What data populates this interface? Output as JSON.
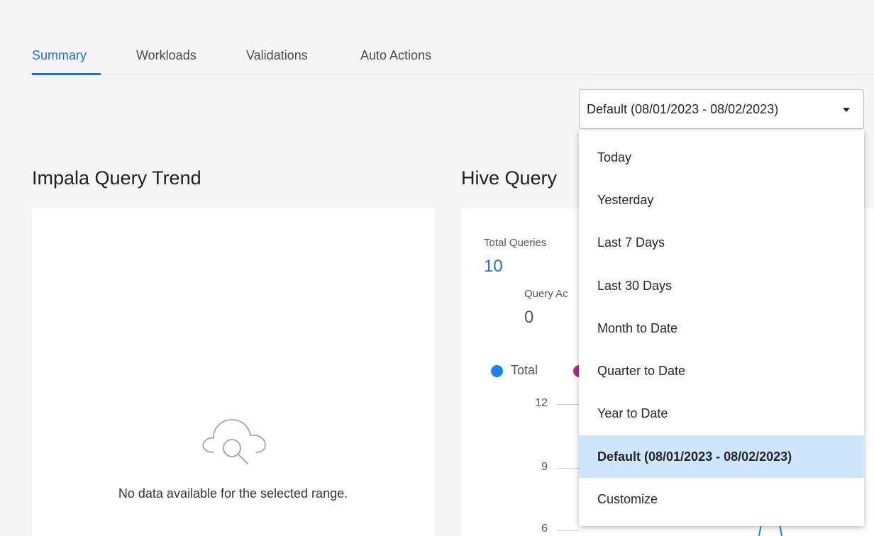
{
  "tabs": [
    {
      "label": "Summary",
      "active": true
    },
    {
      "label": "Workloads",
      "active": false
    },
    {
      "label": "Validations",
      "active": false
    },
    {
      "label": "Auto Actions",
      "active": false
    }
  ],
  "date_range": {
    "selected": "Default (08/01/2023 - 08/02/2023)",
    "options": [
      "Today",
      "Yesterday",
      "Last 7 Days",
      "Last 30 Days",
      "Month to Date",
      "Quarter to Date",
      "Year to Date",
      "Default (08/01/2023 - 08/02/2023)",
      "Customize"
    ],
    "selected_index": 7
  },
  "impala": {
    "title": "Impala Query Trend",
    "empty_message": "No data available for the selected range.",
    "empty_icon": "cloud-search-icon"
  },
  "hive": {
    "title": "Hive Query",
    "total_queries_label": "Total Queries",
    "total_queries_value": "10",
    "query_actions_label": "Query Ac",
    "query_actions_value": "0",
    "legend_total": "Total",
    "y_ticks": [
      "12",
      "9",
      "6"
    ]
  },
  "colors": {
    "accent": "#1f6fd6",
    "legend_total": "#1a84f0",
    "legend_second": "#c2268f",
    "selected_bg": "#cde6fb"
  }
}
